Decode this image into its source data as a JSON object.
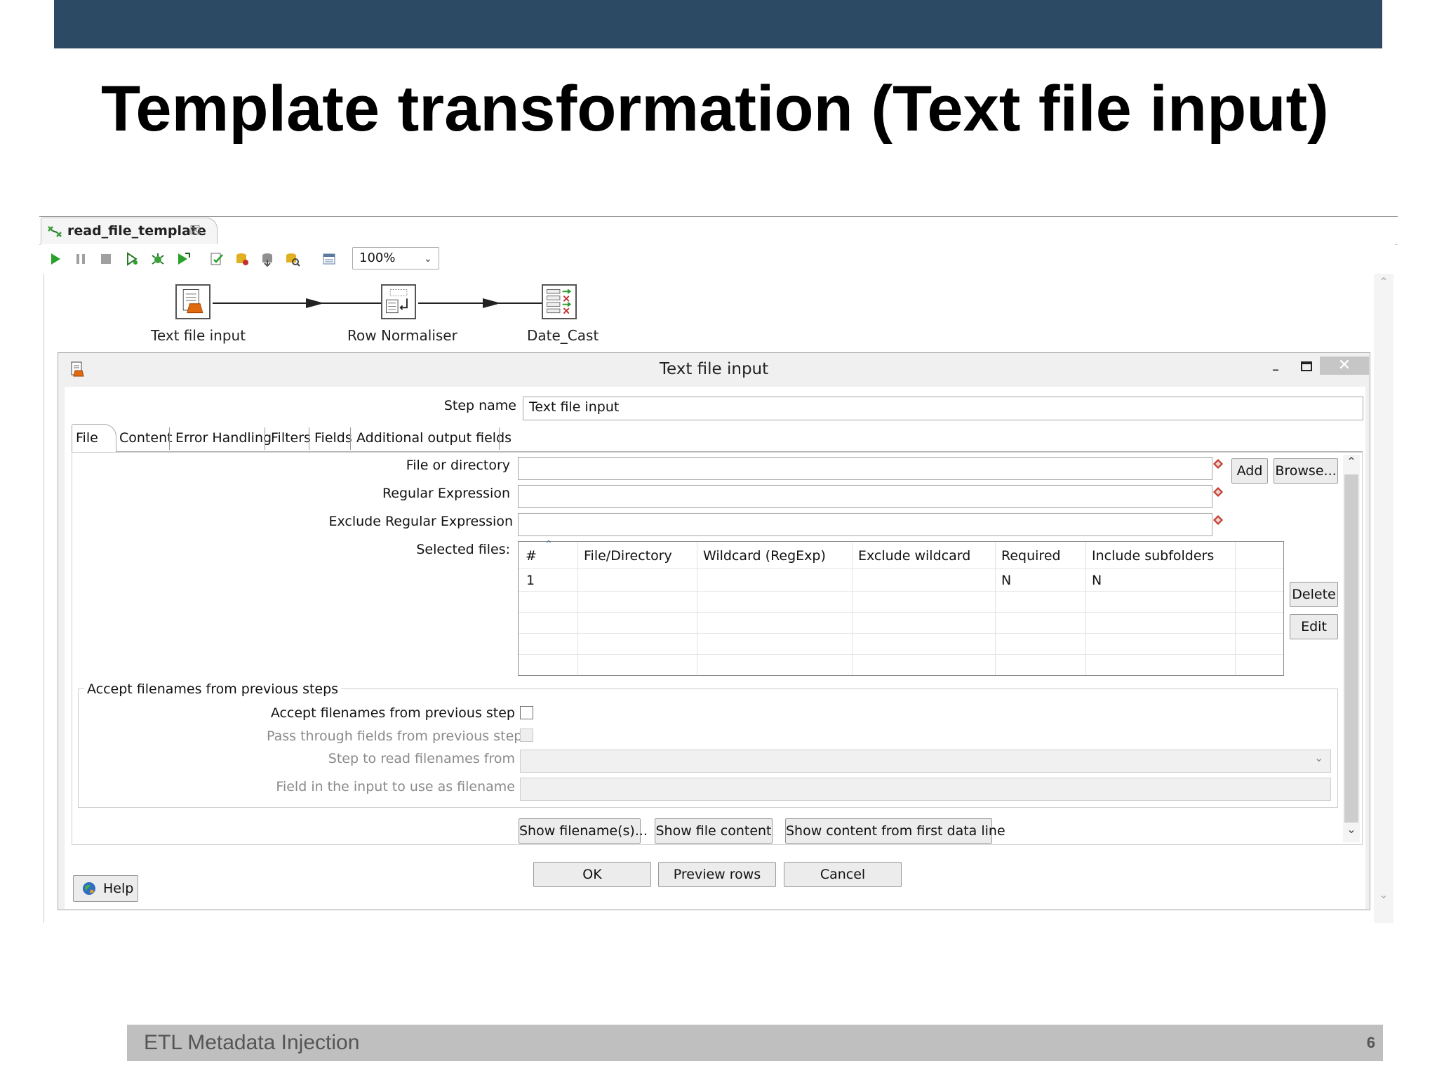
{
  "slide": {
    "title": "Template transformation (Text file input)",
    "footer": "ETL Metadata Injection",
    "page_number": "6"
  },
  "editor": {
    "tab_label": "read_file_template",
    "tab_close": "☒",
    "zoom": "100%",
    "toolbar_icons": [
      "run-icon",
      "pause-icon",
      "stop-icon",
      "preview-icon",
      "debug-icon",
      "replay-icon",
      "verify-icon",
      "impact-icon",
      "sql-icon",
      "explore-db-icon",
      "results-icon"
    ]
  },
  "canvas": {
    "steps": [
      {
        "label": "Text file input",
        "icon": "text-file-input-icon"
      },
      {
        "label": "Row Normaliser",
        "icon": "row-normaliser-icon"
      },
      {
        "label": "Date_Cast",
        "icon": "select-values-icon"
      }
    ]
  },
  "dialog": {
    "title": "Text file input",
    "minimize": "–",
    "close": "✕",
    "step_name_label": "Step name",
    "step_name_value": "Text file input",
    "tabs": [
      "File",
      "Content",
      "Error Handling",
      "Filters",
      "Fields",
      "Additional output fields"
    ],
    "active_tab": "File",
    "file_or_directory_label": "File or directory",
    "file_or_directory_value": "",
    "regex_label": "Regular Expression",
    "regex_value": "",
    "exclude_regex_label": "Exclude Regular Expression",
    "exclude_regex_value": "",
    "add_button": "Add",
    "browse_button": "Browse...",
    "selected_files_label": "Selected files:",
    "grid": {
      "columns": [
        "#",
        "File/Directory",
        "Wildcard (RegExp)",
        "Exclude wildcard",
        "Required",
        "Include subfolders"
      ],
      "rows": [
        {
          "num": "1",
          "file": "",
          "wildcard": "",
          "exclude": "",
          "required": "N",
          "subfolders": "N"
        }
      ]
    },
    "delete_button": "Delete",
    "edit_button": "Edit",
    "group": {
      "title": "Accept filenames from previous steps",
      "accept_label": "Accept filenames from previous step",
      "accept_checked": false,
      "pass_through_label": "Pass through fields from previous step",
      "pass_through_checked": false,
      "step_to_read_label": "Step to read filenames from",
      "step_to_read_value": "",
      "field_label": "Field in the input to use as filename",
      "field_value": ""
    },
    "show_filenames_button": "Show filename(s)...",
    "show_file_content_button": "Show file content",
    "show_content_first_line_button": "Show content from first data line",
    "ok_button": "OK",
    "preview_button": "Preview rows",
    "cancel_button": "Cancel",
    "help_button": "Help"
  },
  "colors": {
    "top_bar": "#2c4a63",
    "footer_bar": "#bfbfbf",
    "dialog_bg": "#f0f0f0",
    "run_green": "#2aa12a",
    "var_icon_red": "#c0392b"
  }
}
